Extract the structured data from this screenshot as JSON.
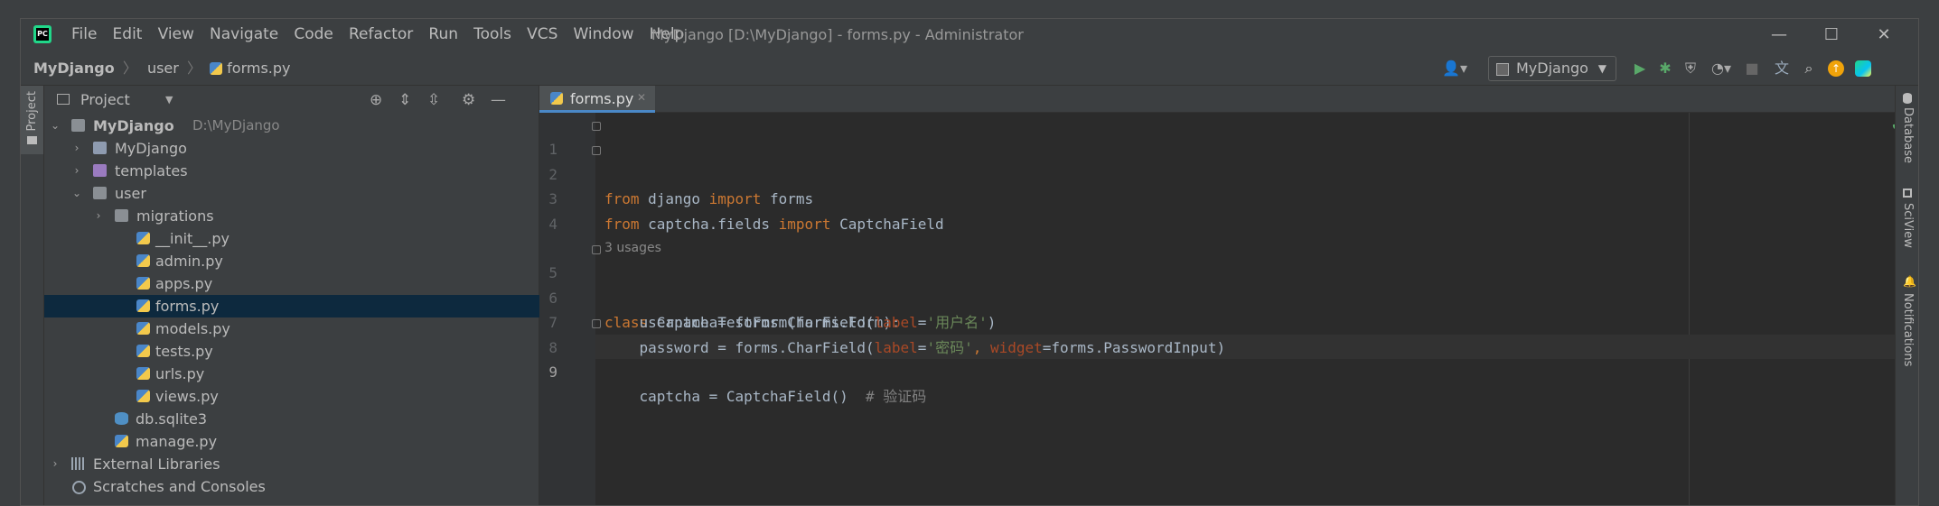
{
  "app": {
    "logo_text": "PC",
    "title": "MyDjango [D:\\MyDjango] - forms.py - Administrator"
  },
  "menu": [
    "File",
    "Edit",
    "View",
    "Navigate",
    "Code",
    "Refactor",
    "Run",
    "Tools",
    "VCS",
    "Window",
    "Help"
  ],
  "window_controls": {
    "minimize": "—",
    "maximize": "☐",
    "close": "✕"
  },
  "breadcrumb": {
    "project": "MyDjango",
    "folder": "user",
    "file": "forms.py"
  },
  "toolbar": {
    "run_config": "MyDjango",
    "icons": [
      "user-icon",
      "run-icon",
      "debug-icon",
      "coverage-icon",
      "profile-icon",
      "stop-icon",
      "translate-icon",
      "search-icon",
      "update-icon",
      "logo-icon"
    ]
  },
  "left_stripe": {
    "project_tab": "Project"
  },
  "project_panel": {
    "title": "Project",
    "tree": [
      {
        "label": "MyDjango",
        "hint": "D:\\MyDjango",
        "kind": "folder",
        "bold": true
      },
      {
        "label": "MyDjango",
        "kind": "folder-blue"
      },
      {
        "label": "templates",
        "kind": "folder-purple"
      },
      {
        "label": "user",
        "kind": "folder"
      },
      {
        "label": "migrations",
        "kind": "folder"
      },
      {
        "label": "__init__.py",
        "kind": "py"
      },
      {
        "label": "admin.py",
        "kind": "py"
      },
      {
        "label": "apps.py",
        "kind": "py"
      },
      {
        "label": "forms.py",
        "kind": "py",
        "selected": true
      },
      {
        "label": "models.py",
        "kind": "py"
      },
      {
        "label": "tests.py",
        "kind": "py"
      },
      {
        "label": "urls.py",
        "kind": "py"
      },
      {
        "label": "views.py",
        "kind": "py"
      },
      {
        "label": "db.sqlite3",
        "kind": "db"
      },
      {
        "label": "manage.py",
        "kind": "py"
      },
      {
        "label": "External Libraries",
        "kind": "lib"
      },
      {
        "label": "Scratches and Consoles",
        "kind": "scratch"
      }
    ]
  },
  "editor": {
    "tab_label": "forms.py",
    "inlay_hint": "3 usages",
    "lines": {
      "l1": {
        "n": "1",
        "kw1": "from",
        "mod": " django ",
        "kw2": "import",
        "name": " forms"
      },
      "l2": {
        "n": "2",
        "kw1": "from",
        "mod": " captcha.fields ",
        "kw2": "import",
        "name": " CaptchaField"
      },
      "l3": {
        "n": "3"
      },
      "l4": {
        "n": "4"
      },
      "l5": {
        "n": "5",
        "kw": "class",
        "rest": " CaptchaTestForm(forms.Form):"
      },
      "l6": {
        "n": "6",
        "a": "    username = forms.CharField(",
        "p": "label",
        "eq": "=",
        "s": "'用户名'",
        "close": ")"
      },
      "l7": {
        "n": "7",
        "a": "    password = forms.CharField(",
        "p1": "label",
        "eq1": "=",
        "s1": "'密码'",
        "comma": ", ",
        "p2": "widget",
        "eq2": "=",
        "b": "forms.PasswordInput)"
      },
      "l8": {
        "n": "8",
        "a": "    captcha = CaptchaField()  ",
        "c": "# 验证码"
      },
      "l9": {
        "n": "9"
      }
    }
  },
  "right_stripe": {
    "database": "Database",
    "sciview": "SciView",
    "notifications": "Notifications"
  },
  "colors": {
    "keyword": "#cc7832",
    "string": "#6a8759",
    "param": "#aa4926",
    "comment": "#808080",
    "selection": "#0d293e",
    "tab_underline": "#4a88c7"
  }
}
